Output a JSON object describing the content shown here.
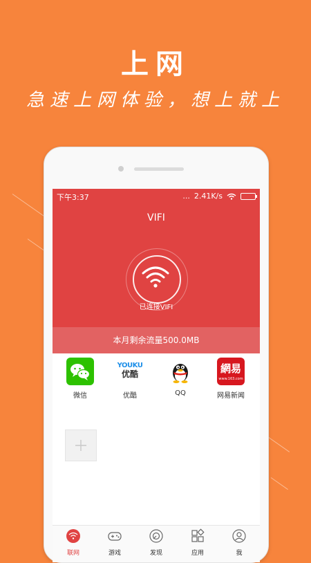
{
  "promo": {
    "title": "上网",
    "subtitle": "急速上网体验，想上就上"
  },
  "status_bar": {
    "time": "下午3:37",
    "signal": "...",
    "speed": "2.41K/s"
  },
  "hero": {
    "title": "VIFI",
    "connection_status": "已连接VIFI",
    "quota_text": "本月剩余流量500.0MB"
  },
  "apps": [
    {
      "label": "微信",
      "icon": "wechat-icon"
    },
    {
      "label": "优酷",
      "icon": "youku-icon",
      "logo_text": "YOUKU",
      "logo_sub": "优酷"
    },
    {
      "label": "QQ",
      "icon": "qq-penguin-icon"
    },
    {
      "label": "网易新闻",
      "icon": "netease-news-icon",
      "logo_text": "網易",
      "logo_sub": "www.163.com"
    }
  ],
  "add_tile": {
    "icon": "plus-icon"
  },
  "tabs": [
    {
      "label": "联网",
      "icon": "wifi-icon",
      "active": true
    },
    {
      "label": "游戏",
      "icon": "gamepad-icon",
      "active": false
    },
    {
      "label": "发现",
      "icon": "compass-icon",
      "active": false
    },
    {
      "label": "应用",
      "icon": "apps-grid-icon",
      "active": false
    },
    {
      "label": "我",
      "icon": "user-icon",
      "active": false
    }
  ],
  "colors": {
    "background": "#f7843c",
    "hero": "#e04342",
    "quota_band": "#e26262",
    "active_tab": "#e04342"
  }
}
